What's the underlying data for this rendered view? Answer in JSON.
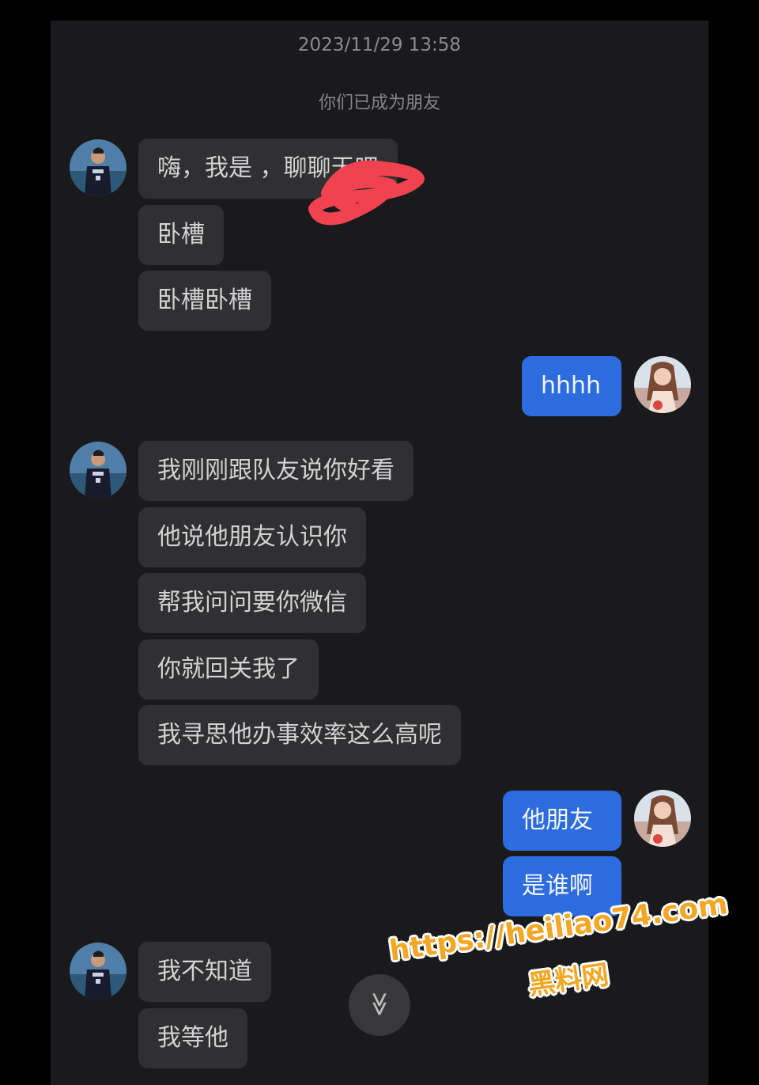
{
  "chat": {
    "timestamp": "2023/11/29 13:58",
    "system_message": "你们已成为朋友",
    "messages": [
      {
        "sender": "other",
        "text": "嗨，我是              ，聊聊天吧"
      },
      {
        "sender": "other",
        "text": "卧槽"
      },
      {
        "sender": "other",
        "text": "卧槽卧槽"
      },
      {
        "sender": "me",
        "text": "hhhh"
      },
      {
        "sender": "other",
        "text": "我刚刚跟队友说你好看"
      },
      {
        "sender": "other",
        "text": "他说他朋友认识你"
      },
      {
        "sender": "other",
        "text": "帮我问问要你微信"
      },
      {
        "sender": "other",
        "text": "你就回关我了"
      },
      {
        "sender": "other",
        "text": "我寻思他办事效率这么高呢"
      },
      {
        "sender": "me",
        "text": "他朋友"
      },
      {
        "sender": "me",
        "text": "是谁啊"
      },
      {
        "sender": "other",
        "text": "我不知道"
      },
      {
        "sender": "other",
        "text": "我等他"
      }
    ]
  },
  "scroll_button": {
    "icon": "double-chevron-down-icon",
    "glyph": "≫"
  },
  "watermark": {
    "url": "https://heiliao74.com",
    "name": "黑料网"
  },
  "colors": {
    "background": "#1a1a1c",
    "bubble_other": "#303033",
    "bubble_me": "#2d6cdf",
    "redaction": "#f0434f",
    "watermark": "#f5a623"
  }
}
